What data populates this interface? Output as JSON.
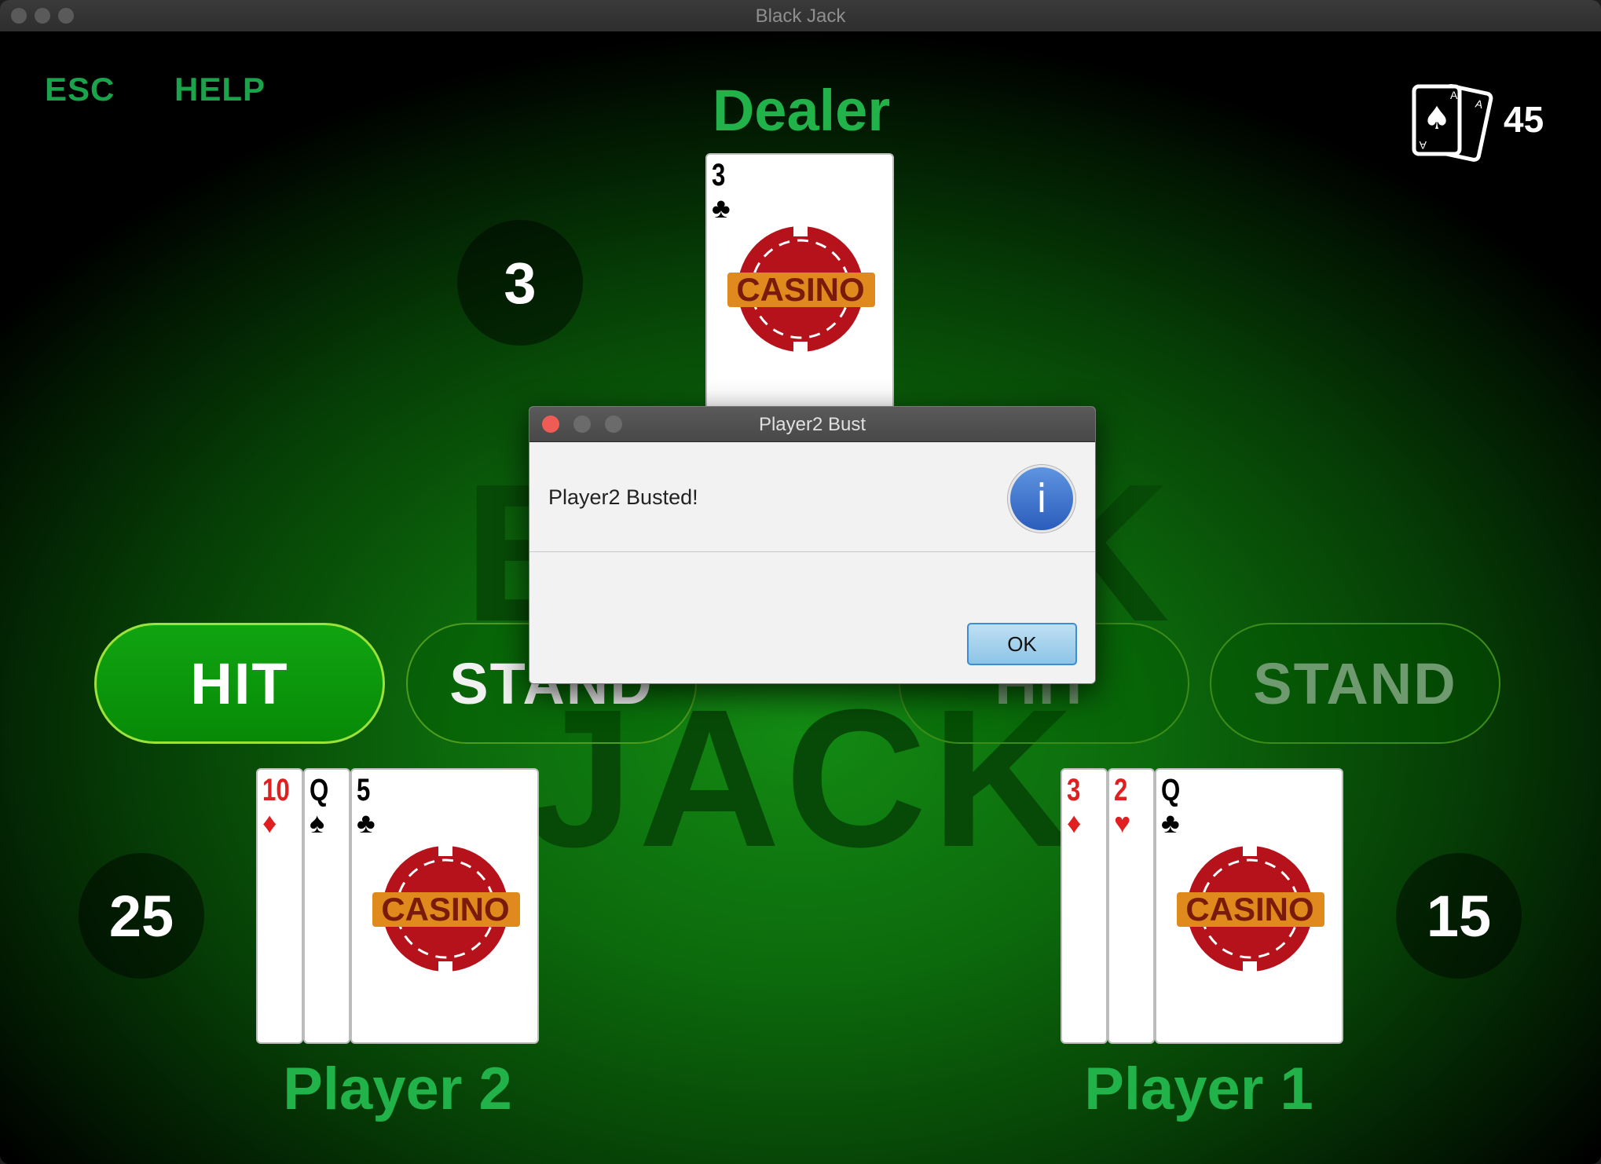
{
  "window": {
    "title": "Black Jack"
  },
  "nav": {
    "esc": "ESC",
    "help": "HELP"
  },
  "deck": {
    "count": "45"
  },
  "dealer": {
    "label": "Dealer",
    "score": "3",
    "card": {
      "rank": "3",
      "suit": "♣",
      "color": "black"
    }
  },
  "table_title": "BLACK JACK",
  "player2": {
    "label": "Player 2",
    "score": "25",
    "hit_label": "HIT",
    "stand_label": "STAND",
    "cards": [
      {
        "rank": "10",
        "suit": "♦",
        "color": "red"
      },
      {
        "rank": "Q",
        "suit": "♠",
        "color": "black"
      },
      {
        "rank": "5",
        "suit": "♣",
        "color": "black"
      }
    ]
  },
  "player1": {
    "label": "Player 1",
    "score": "15",
    "hit_label": "HIT",
    "stand_label": "STAND",
    "cards": [
      {
        "rank": "3",
        "suit": "♦",
        "color": "red"
      },
      {
        "rank": "2",
        "suit": "♥",
        "color": "red"
      },
      {
        "rank": "Q",
        "suit": "♣",
        "color": "black"
      }
    ]
  },
  "card_back_logo": "CASINO",
  "dialog": {
    "title": "Player2 Bust",
    "message": "Player2 Busted!",
    "ok_label": "OK",
    "icon": "info-icon"
  }
}
